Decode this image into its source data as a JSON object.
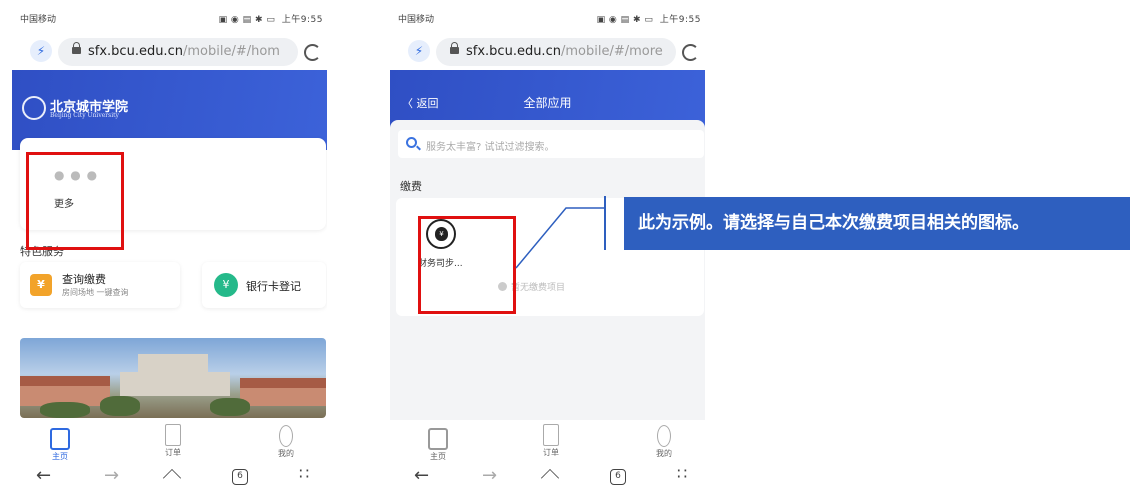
{
  "status_bar": {
    "carrier": "中国移动",
    "time": "上午9:55"
  },
  "left_phone": {
    "url_host": "sfx.bcu.edu.cn",
    "url_path": "/mobile/#/hom",
    "school_name": "北京城市学院",
    "school_name_en": "Beijing City University",
    "more_label": "更多",
    "section_title": "特色服务",
    "services": [
      {
        "title": "查询缴费",
        "subtitle": "房间场地 一键查询",
        "icon": "yen-receipt-icon"
      },
      {
        "title": "银行卡登记",
        "icon": "yen-coin-icon"
      }
    ]
  },
  "right_phone": {
    "url_host": "sfx.bcu.edu.cn",
    "url_path": "/mobile/#/more",
    "back_label": "〈 返回",
    "page_title": "全部应用",
    "search_placeholder": "服务太丰富? 试试过滤搜索。",
    "category_label": "缴费",
    "item_label": "财务司步...",
    "empty_hint": "暂无缴费项目"
  },
  "tabs": [
    {
      "label": "主页",
      "active": true
    },
    {
      "label": "订单",
      "active": false
    },
    {
      "label": "我的",
      "active": false
    }
  ],
  "callout": {
    "text": "此为示例。请选择与自己本次缴费项目相关的图标。"
  },
  "colors": {
    "header_blue": "#3558cf",
    "annotation_red": "#e01010",
    "callout_blue": "#2e5fbf"
  }
}
